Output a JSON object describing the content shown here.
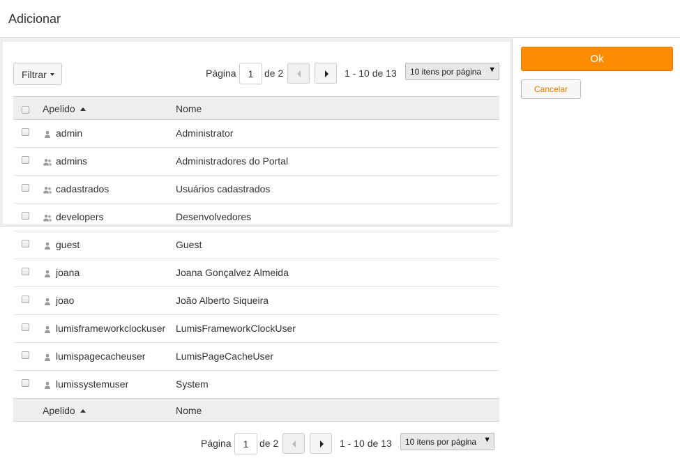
{
  "dialog": {
    "title": "Adicionar"
  },
  "actions": {
    "ok_label": "Ok",
    "cancel_label": "Cancelar"
  },
  "filter": {
    "label": "Filtrar"
  },
  "pagination": {
    "page_label": "Página",
    "current_page": "1",
    "of_label": "de 2",
    "range_text": "1 - 10 de 13",
    "per_page_label": "10 itens por página"
  },
  "table": {
    "columns": [
      "Apelido",
      "Nome"
    ],
    "rows": [
      {
        "apelido": "admin",
        "nome": "Administrator",
        "icon": "user-icon"
      },
      {
        "apelido": "admins",
        "nome": "Administradores do Portal",
        "icon": "group-icon"
      },
      {
        "apelido": "cadastrados",
        "nome": "Usuários cadastrados",
        "icon": "group-icon"
      },
      {
        "apelido": "developers",
        "nome": "Desenvolvedores",
        "icon": "group-icon"
      },
      {
        "apelido": "guest",
        "nome": "Guest",
        "icon": "user-icon"
      },
      {
        "apelido": "joana",
        "nome": "Joana Gonçalvez Almeida",
        "icon": "user-icon"
      },
      {
        "apelido": "joao",
        "nome": "João Alberto Siqueira",
        "icon": "user-icon"
      },
      {
        "apelido": "lumisframeworkclockuser",
        "nome": "LumisFrameworkClockUser",
        "icon": "user-icon"
      },
      {
        "apelido": "lumispagecacheuser",
        "nome": "LumisPageCacheUser",
        "icon": "user-icon"
      },
      {
        "apelido": "lumissystemuser",
        "nome": "System",
        "icon": "user-icon"
      }
    ]
  },
  "colors": {
    "accent": "#fd8c00",
    "header_bg": "#eeeeee"
  }
}
